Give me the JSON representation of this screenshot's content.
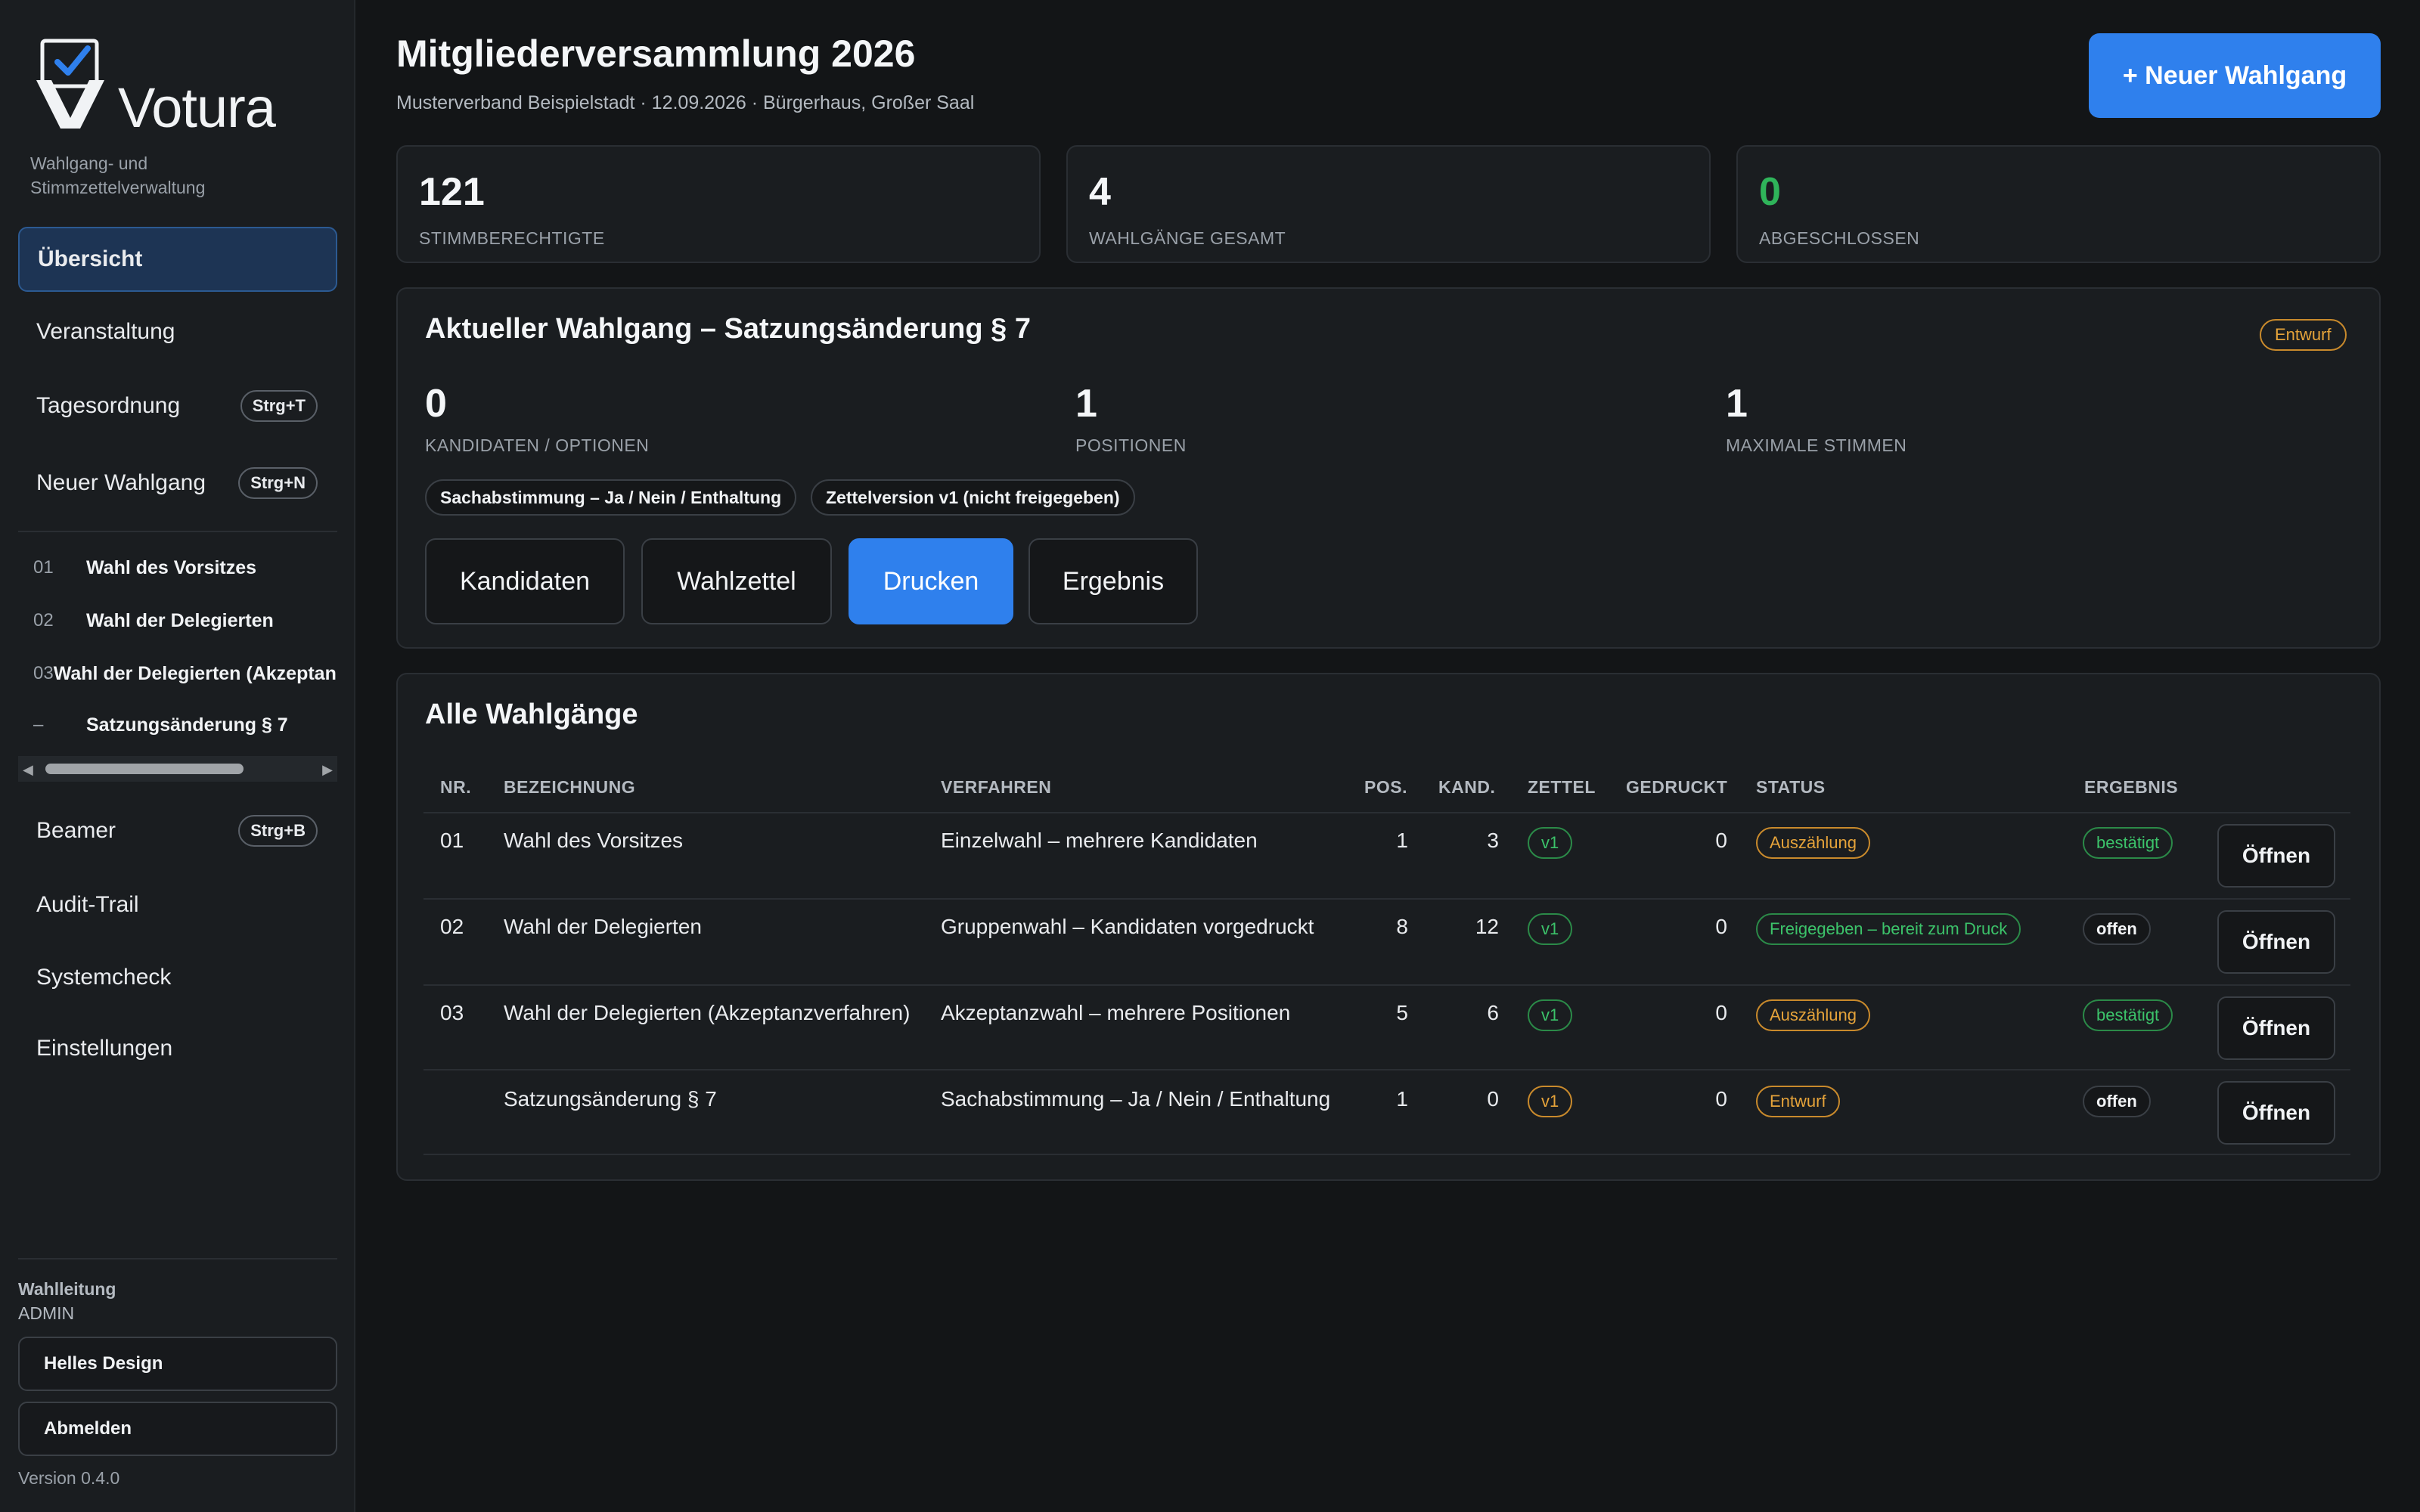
{
  "app": {
    "name": "Votura",
    "tagline": "Wahlgang- und Stimmzettelverwaltung",
    "version": "Version 0.4.0",
    "accent": "#2f80ed"
  },
  "sidebar": {
    "nav": [
      {
        "label": "Übersicht",
        "active": true
      },
      {
        "label": "Veranstaltung"
      },
      {
        "label": "Tagesordnung",
        "shortcut": "Strg+T"
      },
      {
        "label": "Neuer Wahlgang",
        "shortcut": "Strg+N"
      }
    ],
    "ballots": [
      {
        "num": "01",
        "label": "Wahl des Vorsitzes"
      },
      {
        "num": "02",
        "label": "Wahl der Delegierten"
      },
      {
        "num": "03",
        "label": "Wahl der Delegierten (Akzeptanzverfahren)"
      },
      {
        "num": "–",
        "label": "Satzungsänderung § 7"
      }
    ],
    "nav2": [
      {
        "label": "Beamer",
        "shortcut": "Strg+B"
      },
      {
        "label": "Audit-Trail"
      },
      {
        "label": "Systemcheck"
      },
      {
        "label": "Einstellungen"
      }
    ],
    "user_role": "Wahlleitung",
    "user_name": "ADMIN",
    "theme_button": "Helles Design",
    "logout_button": "Abmelden"
  },
  "header": {
    "title": "Mitgliederversammlung 2026",
    "subtitle": "Musterverband Beispielstadt · 12.09.2026 · Bürgerhaus, Großer Saal",
    "new_button": "+ Neuer Wahlgang"
  },
  "stats": [
    {
      "value": "121",
      "label": "STIMMBERECHTIGTE"
    },
    {
      "value": "4",
      "label": "WAHLGÄNGE GESAMT"
    },
    {
      "value": "0",
      "label": "ABGESCHLOSSEN"
    }
  ],
  "current": {
    "title": "Aktueller Wahlgang – Satzungsänderung § 7",
    "badge": "Entwurf",
    "metrics": [
      {
        "value": "0",
        "label": "KANDIDATEN / OPTIONEN"
      },
      {
        "value": "1",
        "label": "POSITIONEN"
      },
      {
        "value": "1",
        "label": "MAXIMALE STIMMEN"
      }
    ],
    "chips": [
      "Sachabstimmung – Ja / Nein / Enthaltung",
      "Zettelversion v1 (nicht freigegeben)"
    ],
    "buttons": [
      "Kandidaten",
      "Wahlzettel",
      "Drucken",
      "Ergebnis"
    ]
  },
  "table": {
    "title": "Alle Wahlgänge",
    "headers": [
      "NR.",
      "BEZEICHNUNG",
      "VERFAHREN",
      "POS.",
      "KAND.",
      "ZETTEL",
      "GEDRUCKT",
      "STATUS",
      "ERGEBNIS"
    ],
    "rows": [
      {
        "nr": "01",
        "name": "Wahl des Vorsitzes",
        "method": "Einzelwahl – mehrere Kandidaten",
        "pos": "1",
        "kand": "3",
        "zettel": "v1",
        "printed": "0",
        "status": "Auszählung",
        "result": "bestätigt"
      },
      {
        "nr": "02",
        "name": "Wahl der Delegierten",
        "method": "Gruppenwahl – Kandidaten vorgedruckt",
        "pos": "8",
        "kand": "12",
        "zettel": "v1",
        "printed": "0",
        "status": "Freigegeben – bereit zum Druck",
        "result": "offen"
      },
      {
        "nr": "03",
        "name": "Wahl der Delegierten (Akzeptanzverfahren)",
        "method": "Akzeptanzwahl – mehrere Positionen",
        "pos": "5",
        "kand": "6",
        "zettel": "v1",
        "printed": "0",
        "status": "Auszählung",
        "result": "bestätigt"
      },
      {
        "nr": "",
        "name": "Satzungsänderung § 7",
        "method": "Sachabstimmung – Ja / Nein / Enthaltung",
        "pos": "1",
        "kand": "0",
        "zettel": "v1",
        "printed": "0",
        "status": "Entwurf",
        "result": "offen"
      }
    ],
    "open_label": "Öffnen"
  }
}
